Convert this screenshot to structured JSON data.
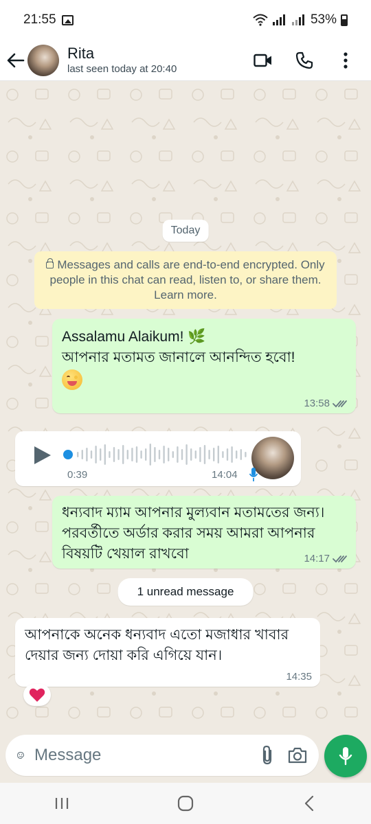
{
  "status_bar": {
    "time": "21:55",
    "battery": "53%"
  },
  "header": {
    "name": "Rita",
    "last_seen": "last seen today at 20:40"
  },
  "chat": {
    "date_chip": "Today",
    "encryption_notice": "Messages and calls are end-to-end encrypted. Only people in this chat can read, listen to, or share them. Learn more.",
    "messages": [
      {
        "line1": "Assalamu Alaikum! 🌿",
        "line2": "আপনার মতামত জানালে আনন্দিত হবো!",
        "time": "13:58"
      },
      {
        "duration": "0:39",
        "time": "14:04"
      },
      {
        "text": "ধন্যবাদ ম্যাম আপনার মুল্যবান মতামতের জন্য। পরবর্তীতে অর্ডার করার সময় আমরা আপনার বিষয়টি খেয়াল রাখবো",
        "time": "14:17"
      },
      {
        "text": "আপনাকে অনেক ধন্যবাদ এতো মজাধার খাবার দেয়ার জন্য দোয়া করি এগিয়ে যান।",
        "time": "14:35",
        "reaction": "❤️"
      }
    ],
    "unread_chip": "1 unread message"
  },
  "composer": {
    "placeholder": "Message"
  },
  "colors": {
    "accent": "#1daa61",
    "outgoing_bubble": "#d9fdd3",
    "wallpaper": "#efeae2",
    "tick": "#667781"
  }
}
